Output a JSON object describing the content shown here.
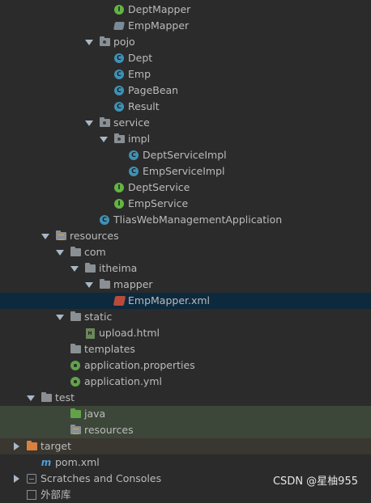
{
  "tree": [
    {
      "label": "DeptMapper",
      "depth": 6,
      "icon": "interface-icon"
    },
    {
      "label": "EmpMapper",
      "depth": 6,
      "icon": "mybatis-mapper-icon"
    },
    {
      "label": "pojo",
      "depth": 5,
      "icon": "package-icon",
      "expanded": true
    },
    {
      "label": "Dept",
      "depth": 6,
      "icon": "class-icon"
    },
    {
      "label": "Emp",
      "depth": 6,
      "icon": "class-icon"
    },
    {
      "label": "PageBean",
      "depth": 6,
      "icon": "class-icon"
    },
    {
      "label": "Result",
      "depth": 6,
      "icon": "class-icon"
    },
    {
      "label": "service",
      "depth": 5,
      "icon": "package-icon",
      "expanded": true
    },
    {
      "label": "impl",
      "depth": 6,
      "icon": "package-icon",
      "expanded": true
    },
    {
      "label": "DeptServiceImpl",
      "depth": 7,
      "icon": "class-icon"
    },
    {
      "label": "EmpServiceImpl",
      "depth": 7,
      "icon": "class-icon"
    },
    {
      "label": "DeptService",
      "depth": 6,
      "icon": "interface-icon"
    },
    {
      "label": "EmpService",
      "depth": 6,
      "icon": "interface-icon"
    },
    {
      "label": "TliasWebManagementApplication",
      "depth": 5,
      "icon": "spring-boot-app-icon"
    },
    {
      "label": "resources",
      "depth": 2,
      "icon": "resources-folder-icon",
      "expanded": true
    },
    {
      "label": "com",
      "depth": 3,
      "icon": "folder-icon",
      "expanded": true
    },
    {
      "label": "itheima",
      "depth": 4,
      "icon": "folder-icon",
      "expanded": true
    },
    {
      "label": "mapper",
      "depth": 5,
      "icon": "folder-icon",
      "expanded": true
    },
    {
      "label": "EmpMapper.xml",
      "depth": 6,
      "icon": "xml-file-icon",
      "selected": true
    },
    {
      "label": "static",
      "depth": 3,
      "icon": "folder-icon",
      "expanded": true
    },
    {
      "label": "upload.html",
      "depth": 4,
      "icon": "html-file-icon"
    },
    {
      "label": "templates",
      "depth": 3,
      "icon": "folder-icon"
    },
    {
      "label": "application.properties",
      "depth": 3,
      "icon": "spring-config-icon"
    },
    {
      "label": "application.yml",
      "depth": 3,
      "icon": "spring-config-icon"
    },
    {
      "label": "test",
      "depth": 1,
      "icon": "folder-icon",
      "expanded": true
    },
    {
      "label": "java",
      "depth": 3,
      "icon": "test-sources-folder-icon",
      "bg": "test"
    },
    {
      "label": "resources",
      "depth": 3,
      "icon": "test-resources-folder-icon",
      "bg": "test"
    },
    {
      "label": "target",
      "depth": 0,
      "icon": "excluded-folder-icon",
      "collapsed": true,
      "bg": "excl"
    },
    {
      "label": "pom.xml",
      "depth": 1,
      "icon": "maven-icon"
    },
    {
      "label": "Scratches and Consoles",
      "depth": 0,
      "icon": "scratches-icon",
      "collapsed": true
    },
    {
      "label": "外部库",
      "depth": 0,
      "icon": "external-libraries-icon"
    }
  ],
  "watermark": "CSDN @星柚955"
}
